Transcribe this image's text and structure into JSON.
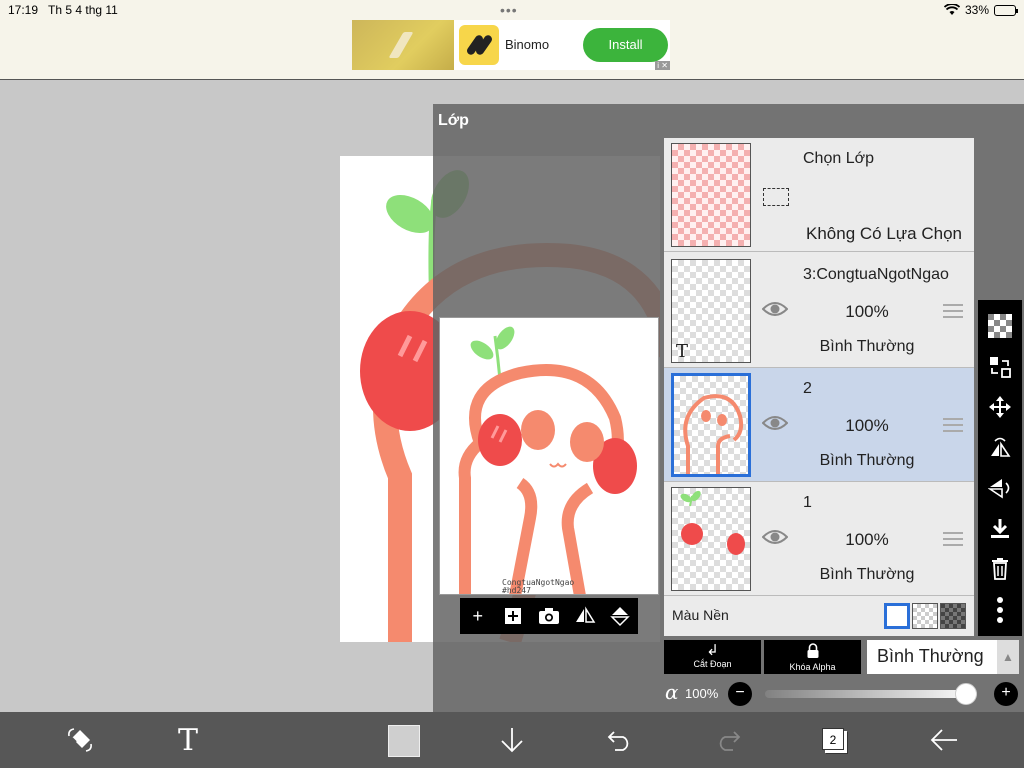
{
  "status_bar": {
    "time": "17:19",
    "date": "Th 5 4 thg 11",
    "battery": "33%",
    "battery_level": 0.33
  },
  "ad": {
    "brand": "Binomo",
    "install_label": "Install",
    "tag": "i ✕"
  },
  "panel": {
    "title": "Lớp",
    "selection_layer": {
      "title": "Chọn Lớp",
      "subtitle": "Không Có Lựa Chọn"
    },
    "layers": [
      {
        "name": "3:CongtuaNgotNgao",
        "opacity": "100%",
        "blend": "Bình Thường",
        "type": "text",
        "text_glyph": "T"
      },
      {
        "name": "2",
        "opacity": "100%",
        "blend": "Bình Thường",
        "selected": true
      },
      {
        "name": "1",
        "opacity": "100%",
        "blend": "Bình Thường"
      }
    ],
    "background_label": "Màu Nền",
    "buttons": {
      "clipping": "Cắt Đoạn",
      "alpha_lock": "Khóa Alpha"
    },
    "blend_mode": "Bình Thường",
    "alpha": {
      "symbol": "α",
      "value": "100%",
      "level": 1.0
    },
    "watermark": "CongtuaNgotNgao",
    "watermark_sub": "#hd247"
  },
  "bottom_toolbar": {
    "text_tool_glyph": "T",
    "layer_count": "2"
  },
  "colors": {
    "accent_blue": "#2a6fd8",
    "selected_layer_bg": "#c9d6ea",
    "character_stroke": "#f58a6e",
    "cheek_red": "#ef4b4b",
    "sprout_green": "#8ee07a",
    "toolbar_bg": "#575757"
  }
}
